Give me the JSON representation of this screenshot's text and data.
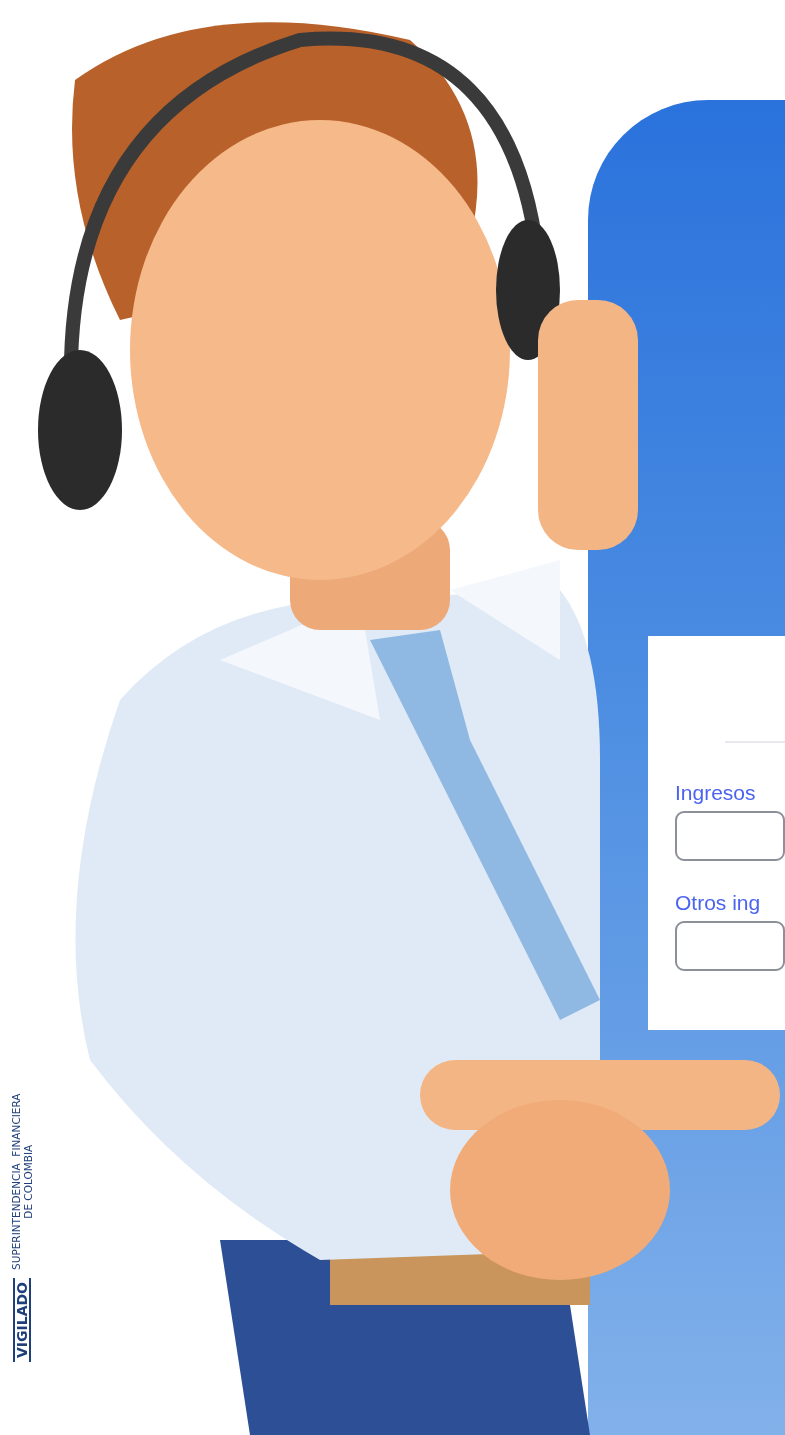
{
  "seal": {
    "badge": "VIGILADO",
    "authority": [
      "SUPERINTENDENCIA  FINANCIERA",
      "DE COLOMBIA"
    ]
  },
  "form": {
    "fields": [
      {
        "label": "Ingresos"
      },
      {
        "label": "Otros ing"
      }
    ]
  }
}
